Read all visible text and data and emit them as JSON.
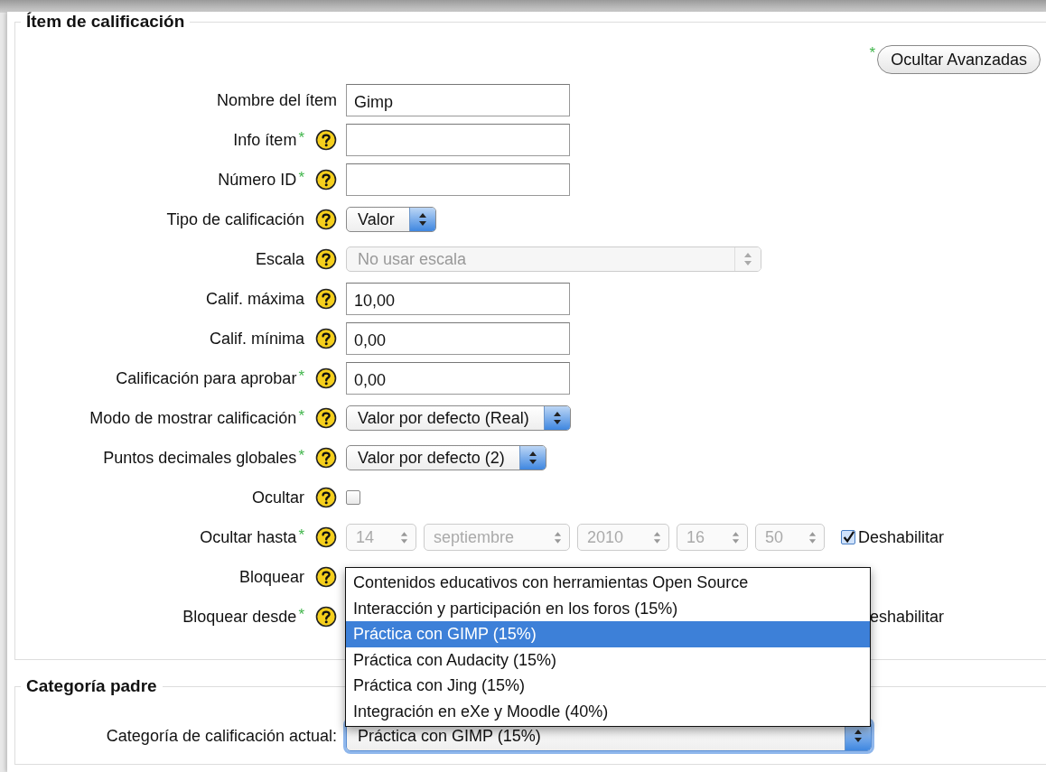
{
  "item_section": {
    "title": "Ítem de calificación",
    "advanced_mark": "*",
    "advanced_button": "Ocultar Avanzadas",
    "rows": [
      {
        "kind": "text",
        "label": "Nombre del ítem",
        "help": false,
        "value": "Gimp"
      },
      {
        "kind": "text",
        "label": "Info ítem",
        "mark": "*",
        "help": true
      },
      {
        "kind": "text",
        "label": "Número ID",
        "mark": "*",
        "help": true
      },
      {
        "kind": "select",
        "label": "Tipo de calificación",
        "help": true,
        "value": "Valor",
        "disabled": false
      },
      {
        "kind": "select",
        "label": "Escala",
        "help": true,
        "value": "No usar escala",
        "disabled": true
      },
      {
        "kind": "text",
        "label": "Calif. máxima",
        "help": true,
        "value": "10,00"
      },
      {
        "kind": "text",
        "label": "Calif. mínima",
        "help": true,
        "value": "0,00"
      },
      {
        "kind": "text",
        "label": "Calificación para aprobar",
        "mark": "*",
        "help": true,
        "value": "0,00"
      },
      {
        "kind": "select",
        "label": "Modo de mostrar calificación",
        "mark": "*",
        "help": true,
        "value": "Valor por defecto (Real)",
        "disabled": false
      },
      {
        "kind": "select",
        "label": "Puntos decimales globales",
        "mark": "*",
        "help": true,
        "value": "Valor por defecto (2)",
        "disabled": false
      },
      {
        "kind": "checkbox",
        "label": "Ocultar",
        "help": true,
        "checked": false
      },
      {
        "kind": "datetime",
        "label": "Ocultar hasta",
        "mark": "*",
        "help": true,
        "parts": [
          "14",
          "septiembre",
          "2010",
          "16",
          "50"
        ],
        "disabled": true,
        "disable_checked": true,
        "disable_label": "Deshabilitar"
      },
      {
        "kind": "covered",
        "label": "Bloquear",
        "help": true
      },
      {
        "kind": "covered",
        "label": "Bloquear desde",
        "mark": "*",
        "help": true,
        "trailing_text": "eshabilitar"
      }
    ]
  },
  "parent_section": {
    "title": "Categoría padre",
    "label": "Categoría de calificación actual:",
    "value": "Práctica con GIMP (15%)",
    "options": [
      {
        "label": "Contenidos educativos con herramientas Open Source",
        "selected": false
      },
      {
        "label": "Interacción y participación en los foros (15%)",
        "selected": false
      },
      {
        "label": "Práctica con GIMP (15%)",
        "selected": true
      },
      {
        "label": "Práctica con Audacity (15%)",
        "selected": false
      },
      {
        "label": "Práctica con Jing (15%)",
        "selected": false
      },
      {
        "label": "Integración en eXe y Moodle (40%)",
        "selected": false
      }
    ]
  }
}
